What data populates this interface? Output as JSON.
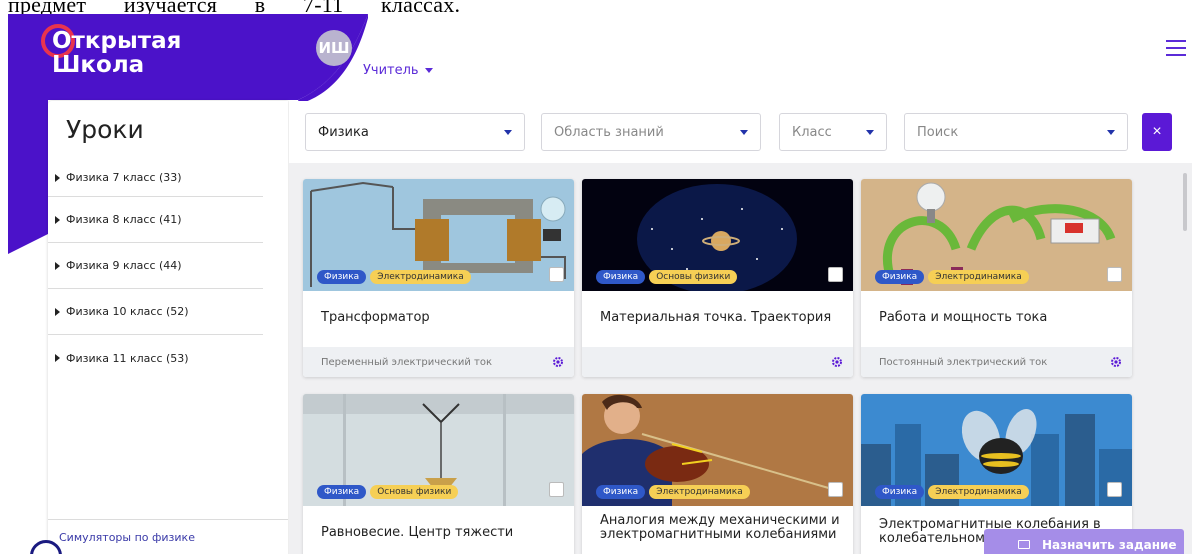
{
  "doc": {
    "words": [
      "предмет",
      "изучается",
      "в",
      "7-11",
      "классах."
    ]
  },
  "brand": {
    "line1": "Открытая",
    "line2": "Школа"
  },
  "user": {
    "initials": "ИШ",
    "role": "Учитель"
  },
  "sidebar": {
    "title": "Уроки",
    "items": [
      {
        "label": "Физика 7 класс (33)"
      },
      {
        "label": "Физика 8 класс (41)"
      },
      {
        "label": "Физика 9 класс (44)"
      },
      {
        "label": "Физика 10 класс (52)"
      },
      {
        "label": "Физика 11 класс (53)"
      }
    ],
    "footer": "Симуляторы по физике"
  },
  "filters": {
    "subject": "Физика",
    "area": "Область знаний",
    "grade": "Класс",
    "search": "Поиск",
    "clear": "×"
  },
  "cards": [
    {
      "title": "Трансформатор",
      "tags": [
        "Физика",
        "Электродинамика"
      ],
      "footer": "Переменный электрический ток"
    },
    {
      "title": "Материальная точка. Траектория",
      "tags": [
        "Физика",
        "Основы физики"
      ],
      "footer": ""
    },
    {
      "title": "Работа и мощность тока",
      "tags": [
        "Физика",
        "Электродинамика"
      ],
      "footer": "Постоянный электрический ток"
    },
    {
      "title": "Равновесие. Центр тяжести",
      "tags": [
        "Физика",
        "Основы физики"
      ],
      "footer": ""
    },
    {
      "title": "Аналогия между механическими и электромагнитными колебаниями",
      "tags": [
        "Физика",
        "Электродинамика"
      ],
      "footer": ""
    },
    {
      "title": "Электромагнитные колебания в колебательном",
      "tags": [
        "Физика",
        "Электродинамика"
      ],
      "footer": ""
    }
  ],
  "assign": {
    "label": "Назначить задание"
  },
  "colors": {
    "brand": "#4b12c9",
    "accent": "#5b19d6",
    "tag_blue": "#2f58c8",
    "tag_yellow": "#f6cf55"
  }
}
